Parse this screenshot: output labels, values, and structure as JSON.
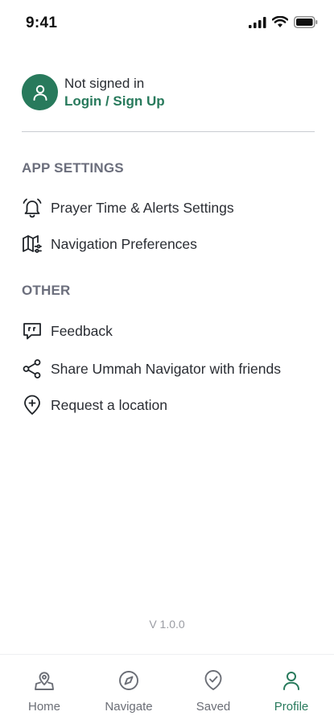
{
  "status_bar": {
    "time": "9:41"
  },
  "account": {
    "status": "Not signed in",
    "login_label": "Login / Sign Up",
    "avatar_icon": "user-icon"
  },
  "sections": {
    "app_settings": {
      "title": "APP SETTINGS",
      "items": [
        {
          "label": "Prayer Time & Alerts Settings",
          "icon": "alarm-bell-icon"
        },
        {
          "label": "Navigation Preferences",
          "icon": "map-settings-icon"
        }
      ]
    },
    "other": {
      "title": "OTHER",
      "items": [
        {
          "label": "Feedback",
          "icon": "chat-bubble-icon"
        },
        {
          "label": "Share Ummah Navigator with friends",
          "icon": "share-icon"
        },
        {
          "label": "Request a location",
          "icon": "add-location-icon"
        }
      ]
    }
  },
  "version": "V 1.0.0",
  "tab_bar": {
    "tabs": [
      {
        "label": "Home",
        "icon": "home-pin-icon",
        "active": false
      },
      {
        "label": "Navigate",
        "icon": "compass-icon",
        "active": false
      },
      {
        "label": "Saved",
        "icon": "saved-shield-icon",
        "active": false
      },
      {
        "label": "Profile",
        "icon": "user-icon",
        "active": true
      }
    ]
  },
  "colors": {
    "accent": "#287a5c",
    "section_title": "#6b6e7c",
    "text": "#2a2d33",
    "muted": "#9a9ca3"
  }
}
